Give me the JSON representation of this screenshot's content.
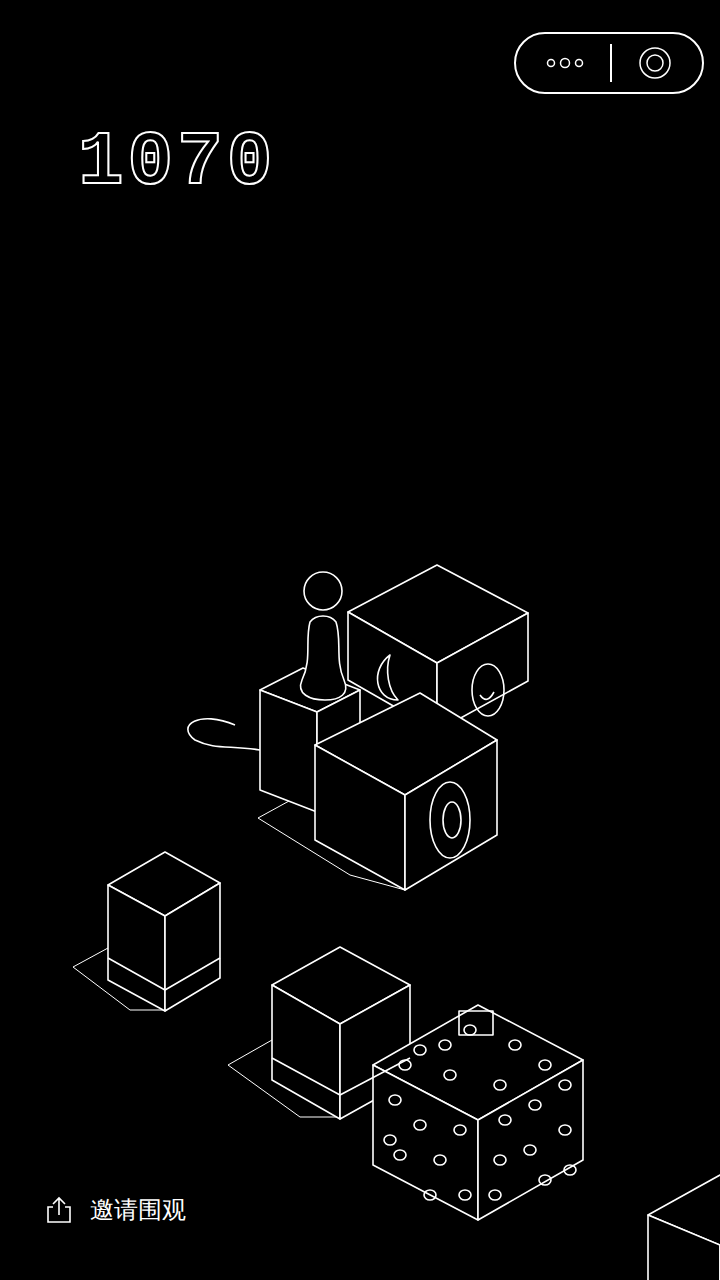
{
  "score": "1070",
  "share": {
    "label": "邀请围观"
  }
}
